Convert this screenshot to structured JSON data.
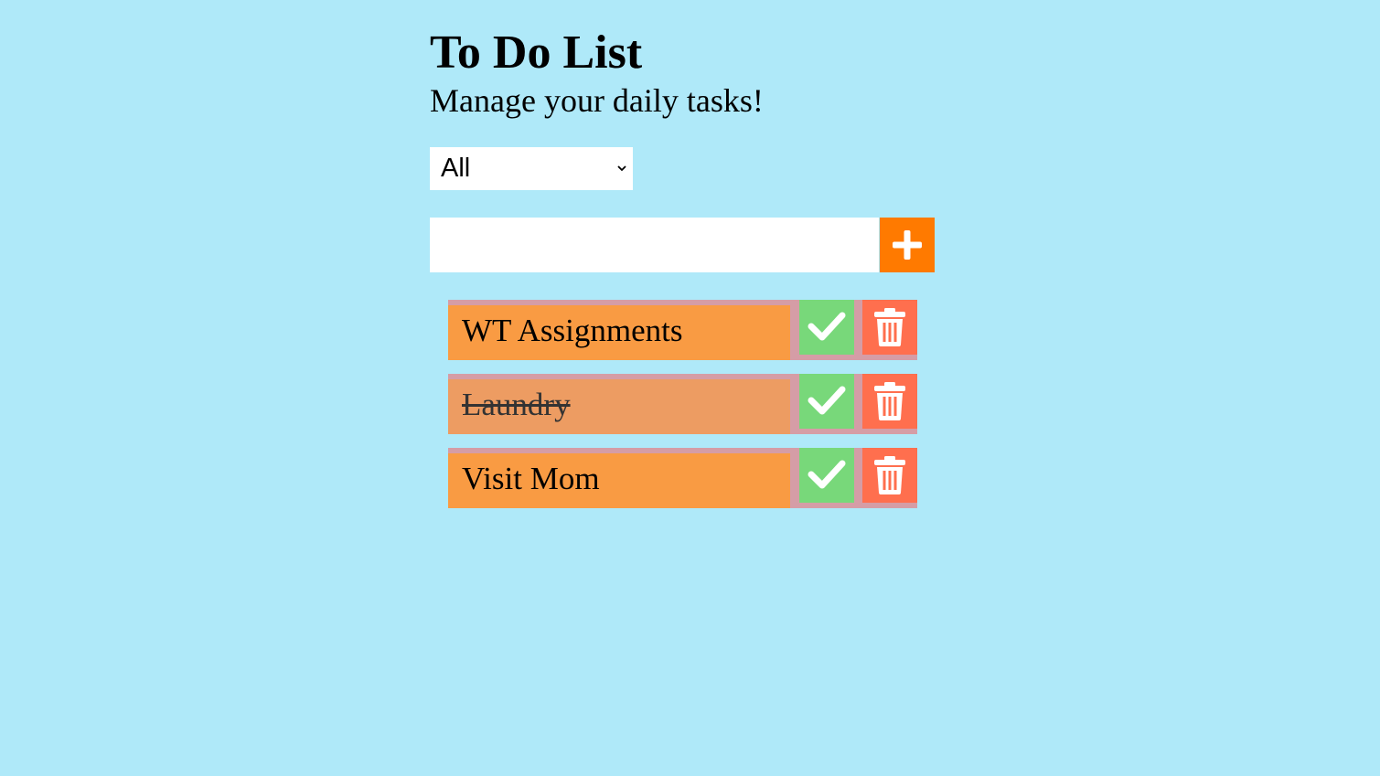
{
  "header": {
    "title": "To Do List",
    "subtitle": "Manage your daily tasks!"
  },
  "filter": {
    "selected": "All"
  },
  "new_task": {
    "value": "",
    "placeholder": ""
  },
  "icons": {
    "add": "plus-icon",
    "complete": "check-icon",
    "delete": "trash-icon",
    "dropdown": "chevron-down-icon"
  },
  "colors": {
    "background": "#afe9f9",
    "add_button": "#ff7a00",
    "task": "#f99b43",
    "task_done": "#ed9c62",
    "check_button": "#78d87a",
    "trash_button": "#ff6f4e"
  },
  "tasks": [
    {
      "text": "WT Assignments",
      "completed": false
    },
    {
      "text": "Laundry",
      "completed": true
    },
    {
      "text": "Visit Mom",
      "completed": false
    }
  ]
}
